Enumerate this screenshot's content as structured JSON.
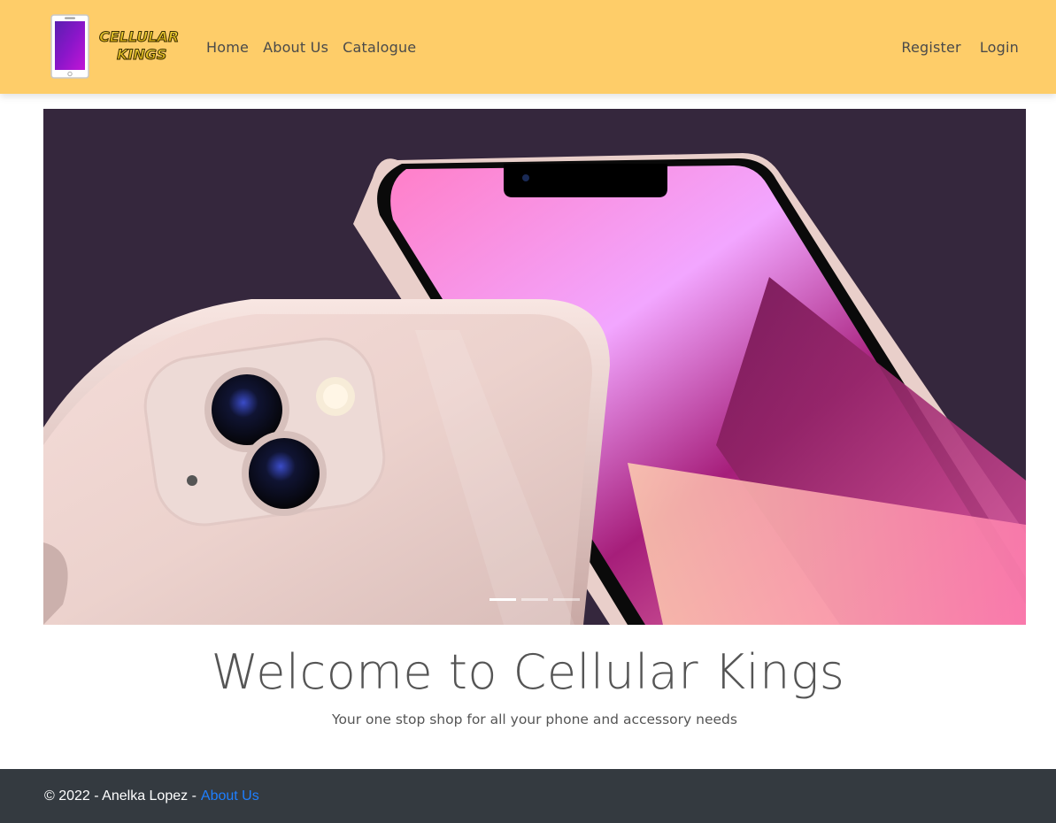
{
  "brand": {
    "logo_text_line1": "CELLULAR",
    "logo_text_line2": "KINGS",
    "logo_icon": "phone-icon"
  },
  "nav": {
    "left": [
      {
        "label": "Home"
      },
      {
        "label": "About Us"
      },
      {
        "label": "Catalogue"
      }
    ],
    "right": [
      {
        "label": "Register"
      },
      {
        "label": "Login"
      }
    ]
  },
  "carousel": {
    "slide_count": 3,
    "active_slide": 1,
    "image": "pink-smartphone-front-and-back"
  },
  "welcome": {
    "title": "Welcome to Cellular Kings",
    "subtitle": "Your one stop shop for all your phone and accessory needs"
  },
  "footer": {
    "copyright": "© 2022 - Anelka Lopez -",
    "link_label": "About Us"
  },
  "colors": {
    "navbar_bg": "#fecd69",
    "carousel_bg": "#35273d",
    "footer_bg": "#343a40",
    "footer_link": "#1e7fff"
  }
}
